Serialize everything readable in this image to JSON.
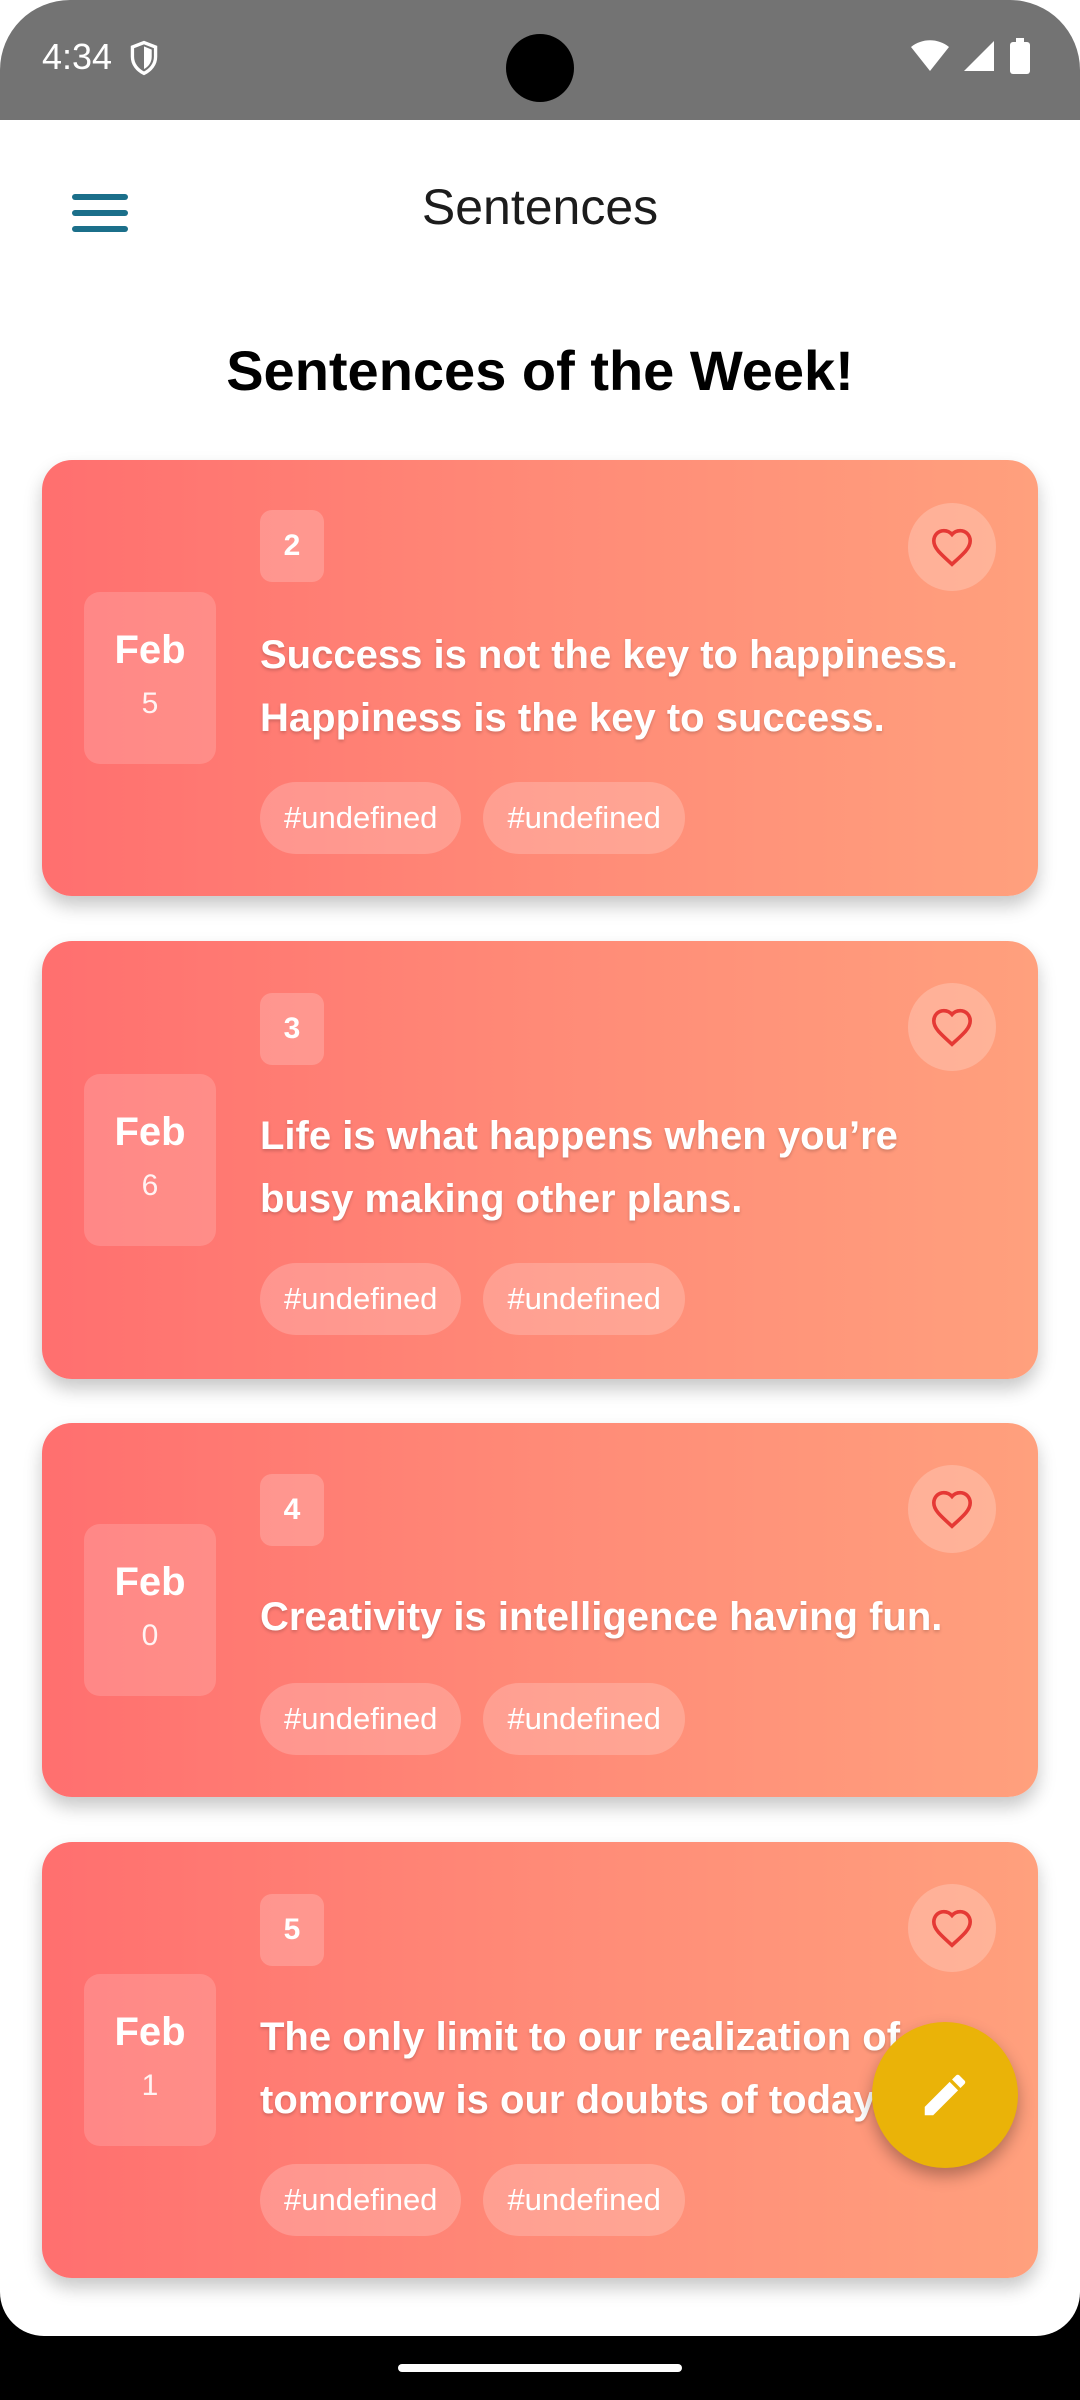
{
  "status_bar": {
    "time": "4:34"
  },
  "app_bar": {
    "title": "Sentences"
  },
  "section_title": "Sentences of the Week!",
  "cards": [
    {
      "month": "Feb",
      "day": "5",
      "number": "2",
      "quote": "Success is not the key to happiness. Happiness is the key to success.",
      "tags": [
        "#undefined",
        "#undefined"
      ]
    },
    {
      "month": "Feb",
      "day": "6",
      "number": "3",
      "quote": "Life is what happens when you’re busy making other plans.",
      "tags": [
        "#undefined",
        "#undefined"
      ]
    },
    {
      "month": "Feb",
      "day": "0",
      "number": "4",
      "quote": "Creativity is intelligence having fun.",
      "tags": [
        "#undefined",
        "#undefined"
      ]
    },
    {
      "month": "Feb",
      "day": "1",
      "number": "5",
      "quote": "The only limit to our realization of tomorrow is our doubts of today.",
      "tags": [
        "#undefined",
        "#undefined"
      ]
    }
  ],
  "icons": {
    "menu": "menu-icon",
    "favorite": "heart-outline-icon",
    "fab": "pencil-icon",
    "shield": "shield-icon",
    "wifi": "wifi-icon",
    "signal": "signal-icon",
    "battery": "battery-icon"
  },
  "colors": {
    "card_gradient_start": "#ff6f6f",
    "card_gradient_end": "#ffa07d",
    "fab": "#eab308",
    "menu_icon": "#1b6f8a",
    "heart": "#e53935"
  }
}
